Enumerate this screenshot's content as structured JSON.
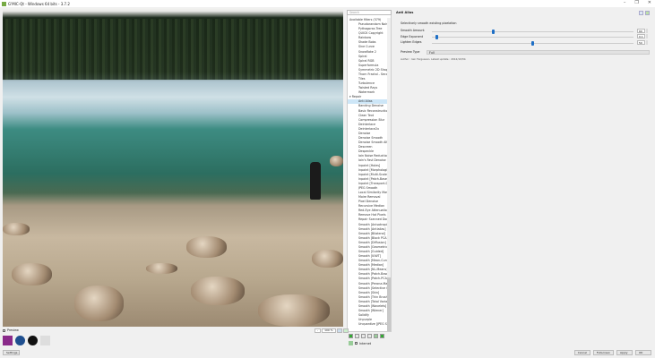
{
  "window": {
    "title": "G'MIC-Qt - Windows 64 bits - 3.7.2",
    "min": "–",
    "max": "❐",
    "close": "✕"
  },
  "filters": {
    "search_placeholder": "Search",
    "items": [
      {
        "label": "Available filters (579)",
        "cat": true
      },
      {
        "label": "Pseudorandom Noise"
      },
      {
        "label": "Pythagoras Tree"
      },
      {
        "label": "QUICK Copyright"
      },
      {
        "label": "Rainbow"
      },
      {
        "label": "Shade Bobs"
      },
      {
        "label": "Sine Curve"
      },
      {
        "label": "Snowflake 2"
      },
      {
        "label": "Spiral"
      },
      {
        "label": "Spiral RGB"
      },
      {
        "label": "Superformula"
      },
      {
        "label": "Symmetric 2D Shape"
      },
      {
        "label": "Thorn Fractal - Secant Se"
      },
      {
        "label": "Tiles"
      },
      {
        "label": "Turbulence"
      },
      {
        "label": "Twisted Rays"
      },
      {
        "label": "Watermark"
      },
      {
        "label": "▾ Repair",
        "cat": true
      },
      {
        "label": "Anti Alias",
        "sel": true
      },
      {
        "label": "Banding Denoise"
      },
      {
        "label": "Basic Reconstruction"
      },
      {
        "label": "Clean Text"
      },
      {
        "label": "Compression Blur"
      },
      {
        "label": "Deinterlace"
      },
      {
        "label": "Deinterlace2x"
      },
      {
        "label": "Denoise"
      },
      {
        "label": "Denoise Smooth"
      },
      {
        "label": "Denoise Smooth Alt"
      },
      {
        "label": "Descreen"
      },
      {
        "label": "Despeckle"
      },
      {
        "label": "Iain Noise Reduction 201"
      },
      {
        "label": "Iain's Fast Denoise"
      },
      {
        "label": "Inpaint [Holes]"
      },
      {
        "label": "Inpaint [Morphological]"
      },
      {
        "label": "Inpaint [Multi-Scale]"
      },
      {
        "label": "Inpaint [Patch-Based]"
      },
      {
        "label": "Inpaint [Transport-Diffusi"
      },
      {
        "label": "JPEG Smooth"
      },
      {
        "label": "Local Similarity Mask"
      },
      {
        "label": "Moire Removal"
      },
      {
        "label": "Pixel Denoise"
      },
      {
        "label": "Recursive Median"
      },
      {
        "label": "Red-Eye Attenuation"
      },
      {
        "label": "Remove Hot Pixels"
      },
      {
        "label": "Repair Scanned Documen"
      },
      {
        "label": "Smooth [Anisotropic]"
      },
      {
        "label": "Smooth [Antialias]"
      },
      {
        "label": "Smooth [Bilateral]"
      },
      {
        "label": "Smooth [Block PCA]"
      },
      {
        "label": "Smooth [Diffusion]"
      },
      {
        "label": "Smooth [Geometric-Med"
      },
      {
        "label": "Smooth [Guided]"
      },
      {
        "label": "Smooth [IUWT]"
      },
      {
        "label": "Smooth [Mean-Curvature"
      },
      {
        "label": "Smooth [Median]"
      },
      {
        "label": "Smooth [NL-Means]"
      },
      {
        "label": "Smooth [Patch-Based]"
      },
      {
        "label": "Smooth [Patch-PCA]"
      },
      {
        "label": "Smooth [Perona-Malik]"
      },
      {
        "label": "Smooth [Selective Gauss"
      },
      {
        "label": "Smooth [Skin]"
      },
      {
        "label": "Smooth [Thin Brush]"
      },
      {
        "label": "Smooth [Total Variation]"
      },
      {
        "label": "Smooth [Wavelets]"
      },
      {
        "label": "Smooth [Wiener]"
      },
      {
        "label": "Solidify"
      },
      {
        "label": "Unpurple"
      },
      {
        "label": "Unquantize [JPEG Smoot"
      }
    ]
  },
  "panel": {
    "title": "Anti Alias",
    "description": "Selectively smooth existing pixelation",
    "params": [
      {
        "label": "Smooth Amount",
        "value": "60",
        "fraction": 0.3
      },
      {
        "label": "Edge Exponent",
        "value": "0.1",
        "fraction": 0.02
      },
      {
        "label": "Lighten Edges",
        "value": "50",
        "fraction": 0.5
      }
    ],
    "preview_type_label": "Preview Type",
    "preview_type": "Full",
    "author": "Author : Iain Fergusson. Latest update : 2012/10/30."
  },
  "preview": {
    "label": "Preview",
    "checked": true
  },
  "zoom": {
    "value": "100 %"
  },
  "internet": {
    "label": "Internet",
    "checked": true
  },
  "logos": [
    "GREYC",
    "CNRS",
    "GMIC",
    "ENSICAEN"
  ],
  "buttons": {
    "settings": "Settings...",
    "cancel": "Cancel",
    "fullscreen": "Fullscreen",
    "apply": "Apply",
    "ok": "OK"
  }
}
